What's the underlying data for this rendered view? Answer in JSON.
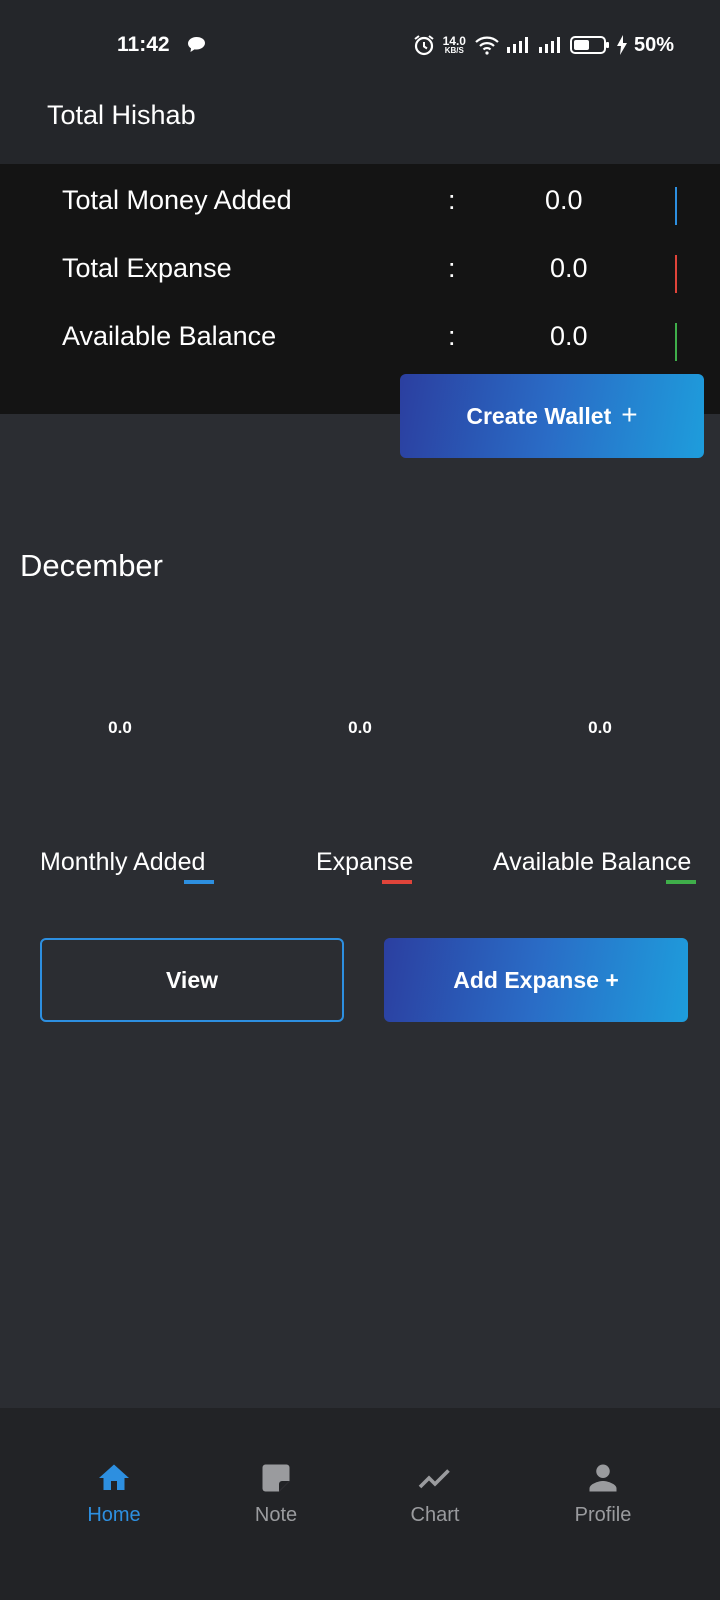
{
  "status": {
    "time": "11:42",
    "net_speed_value": "14.0",
    "net_speed_unit": "KB/S",
    "battery": "50%"
  },
  "app": {
    "title": "Total Hishab"
  },
  "summary": {
    "rows": [
      {
        "label": "Total Money Added",
        "colon": ":",
        "value": "0.0",
        "color": "#2d8fe0"
      },
      {
        "label": "Total Expanse",
        "colon": ":",
        "value": "0.0",
        "color": "#e0443a"
      },
      {
        "label": "Available Balance",
        "colon": ":",
        "value": "0.0",
        "color": "#3fae4a"
      }
    ],
    "create_wallet_label": "Create Wallet",
    "create_wallet_plus": "+"
  },
  "month": {
    "title": "December",
    "values": [
      "0.0",
      "0.0",
      "0.0"
    ],
    "labels": [
      "Monthly Added",
      "Expanse",
      "Available Balance"
    ],
    "underline_colors": [
      "#2d8fe0",
      "#e0443a",
      "#3fae4a"
    ],
    "view_label": "View",
    "add_expanse_label": "Add Expanse +"
  },
  "nav": {
    "items": [
      {
        "label": "Home",
        "icon": "home-icon",
        "active": true
      },
      {
        "label": "Note",
        "icon": "note-icon",
        "active": false
      },
      {
        "label": "Chart",
        "icon": "chart-icon",
        "active": false
      },
      {
        "label": "Profile",
        "icon": "profile-icon",
        "active": false
      }
    ]
  },
  "colors": {
    "accent": "#2d8fe0",
    "background": "#2b2d32",
    "panel": "#141414"
  }
}
